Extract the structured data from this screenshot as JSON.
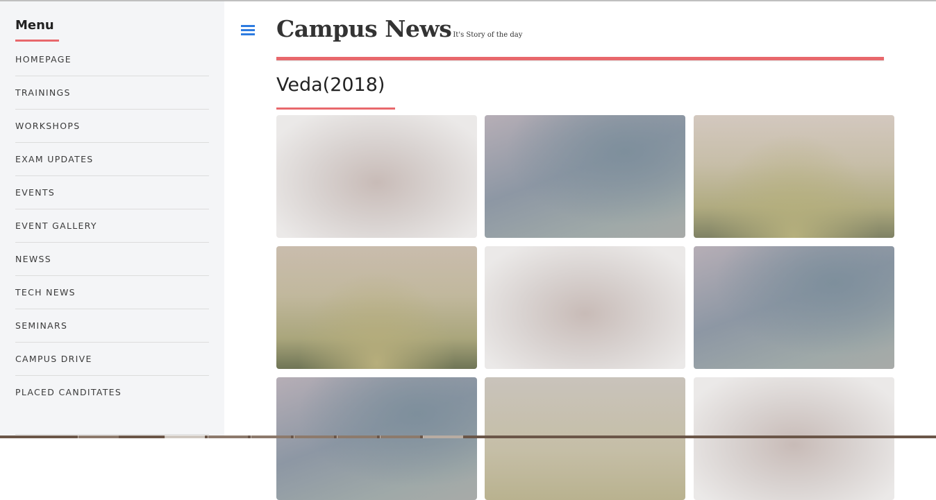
{
  "sidebar": {
    "title": "Menu",
    "items": [
      {
        "label": "HOMEPAGE"
      },
      {
        "label": "TRAININGS"
      },
      {
        "label": "WORKSHOPS"
      },
      {
        "label": "EXAM UPDATES"
      },
      {
        "label": "EVENTS"
      },
      {
        "label": "EVENT GALLERY"
      },
      {
        "label": "NEWSS"
      },
      {
        "label": "TECH NEWS"
      },
      {
        "label": "SEMINARS"
      },
      {
        "label": "CAMPUS DRIVE"
      },
      {
        "label": "PLACED CANDITATES"
      }
    ]
  },
  "header": {
    "menu_icon": "hamburger-icon",
    "title": "Campus News",
    "tagline": "It's Story of the day"
  },
  "section": {
    "title": "Veda(2018)"
  },
  "gallery": {
    "image_count_visible": 9
  },
  "colors": {
    "accent": "#e8686c",
    "icon": "#2d7be0",
    "sidebar_bg": "#f4f5f7",
    "text": "#333333"
  }
}
